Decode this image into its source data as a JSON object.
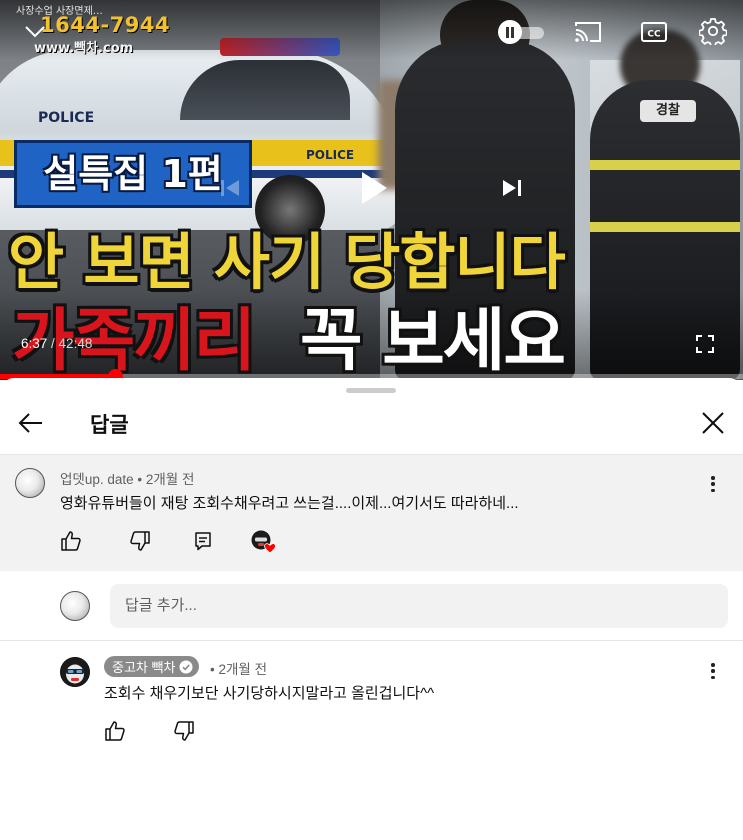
{
  "player": {
    "overlay_top_text": "사장수업 사장면제…",
    "phone": "1644-7944",
    "site": "www.빽차.com",
    "caption_episode": "설특집 1편",
    "caption_line2": "안 보면 사기 당합니다",
    "caption_line3_red": "가족끼리",
    "caption_line3_white": "꼭 보세요",
    "car_text_1": "POLICE",
    "car_text_2": "POLICE",
    "vest_text": "경찰",
    "time_current": "6:37",
    "time_separator": " / ",
    "time_duration": "42:48",
    "progress_fraction": 0.155,
    "icons": [
      "chevron-down-icon",
      "pause-icon",
      "cast-icon",
      "cc-icon",
      "settings-icon",
      "previous-icon",
      "play-icon",
      "next-icon",
      "fullscreen-icon"
    ]
  },
  "sheet": {
    "title": "답글",
    "back_icon": "arrow-left-icon",
    "close_icon": "close-icon"
  },
  "parent_comment": {
    "author": "업뎃up. date",
    "time": " • 2개월 전",
    "text": "영화유튜버들이 재탕 조회수채우려고 쓰는걸....이제...여기서도 따라하네...",
    "actions": [
      "like-icon",
      "dislike-icon",
      "reply-icon",
      "creator-heart-icon"
    ]
  },
  "reply_box": {
    "placeholder": "답글 추가..."
  },
  "reply": {
    "author": "중고차 빽차",
    "time": " • 2개월 전",
    "text": "조회수 채우기보단 사기당하시지말라고 올린겁니다^^",
    "actions": [
      "like-icon",
      "dislike-icon"
    ]
  },
  "colors": {
    "accent": "#ff0000",
    "caption_yellow": "#f0d53a",
    "caption_red": "#d8151c",
    "caption_blue": "#1f64c4",
    "badge_gray": "#8a8a8a"
  }
}
